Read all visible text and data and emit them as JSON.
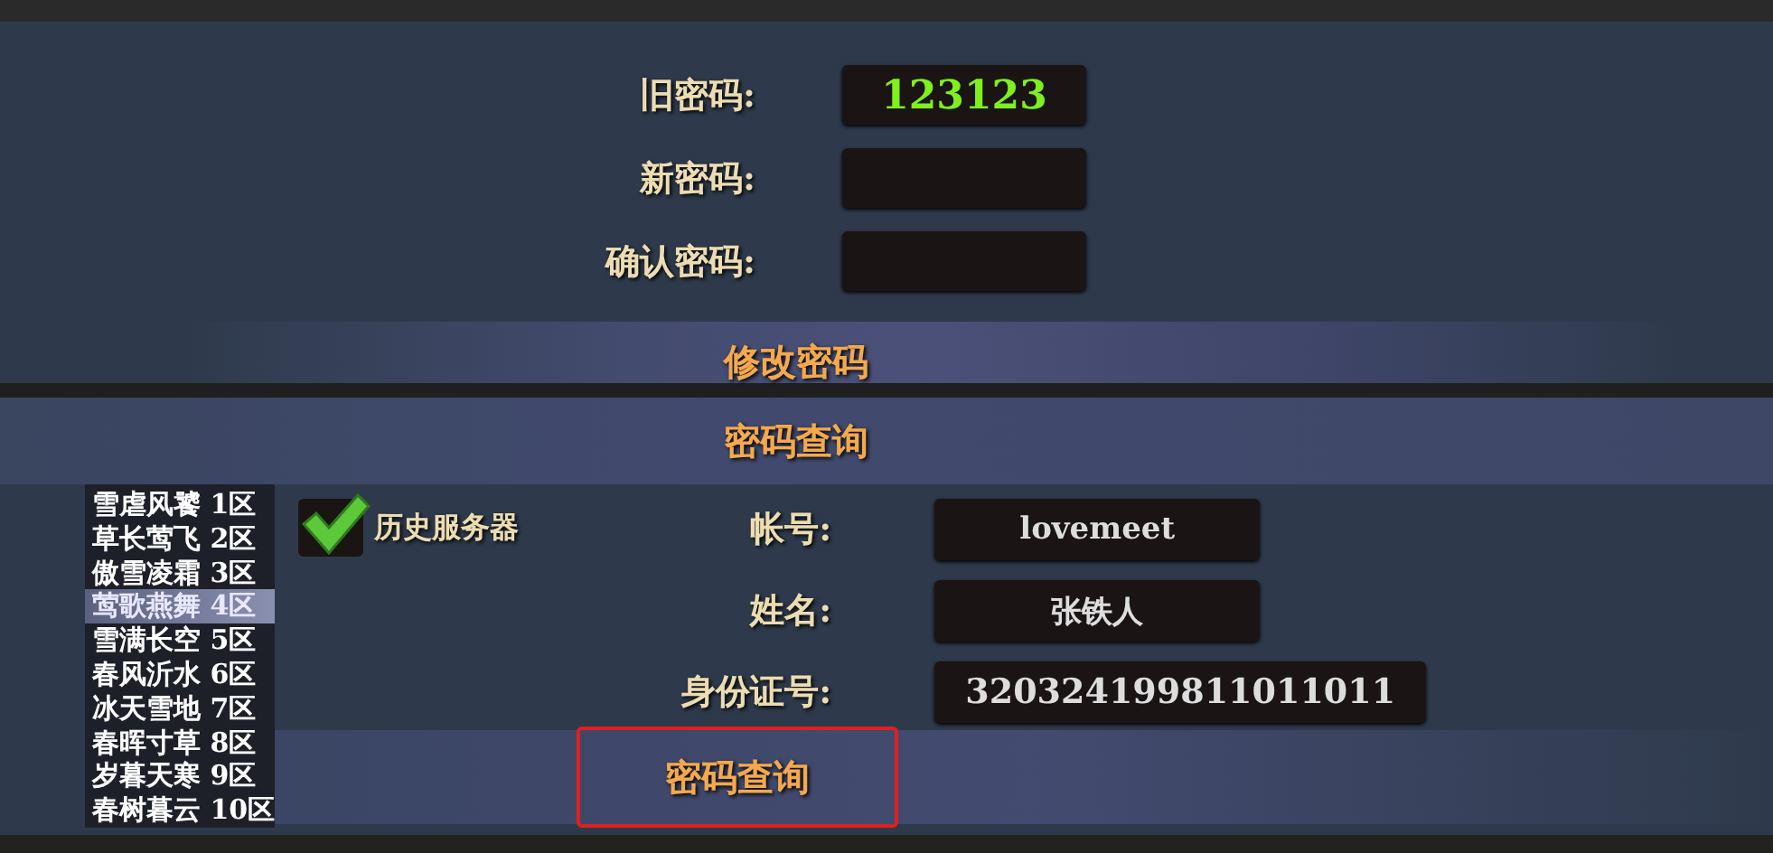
{
  "password_change": {
    "fields": [
      {
        "label": "旧密码:",
        "value": "123123"
      },
      {
        "label": "新密码:"
      },
      {
        "label": "确认密码:"
      }
    ],
    "button": "修改密码"
  },
  "password_query": {
    "title": "密码查询",
    "servers": [
      {
        "name": "雪虐风饕 1区",
        "selected": false
      },
      {
        "name": "草长莺飞 2区",
        "selected": false
      },
      {
        "name": "傲雪凌霜 3区",
        "selected": false
      },
      {
        "name": "莺歌燕舞 4区",
        "selected": true
      },
      {
        "name": "雪满长空 5区",
        "selected": false
      },
      {
        "name": "春风沂水 6区",
        "selected": false
      },
      {
        "name": "冰天雪地 7区",
        "selected": false
      },
      {
        "name": "春晖寸草 8区",
        "selected": false
      },
      {
        "name": "岁暮天寒 9区",
        "selected": false
      },
      {
        "name": "春树暮云 10区",
        "selected": false
      }
    ],
    "history_servers": {
      "label": "历史服务器",
      "checked": true
    },
    "fields": [
      {
        "label": "帐号:",
        "value": "lovemeet"
      },
      {
        "label": "姓名:",
        "value": "张铁人"
      },
      {
        "label": "身份证号:",
        "value": "320324199811011011"
      }
    ],
    "button": {
      "label": "密码查询",
      "highlighted": true
    }
  }
}
